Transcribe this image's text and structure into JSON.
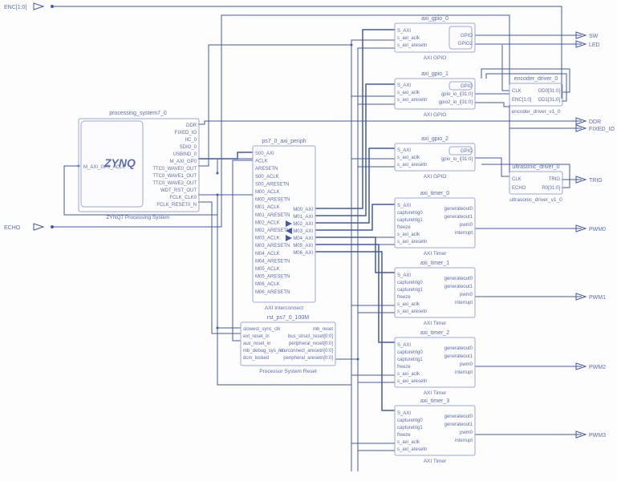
{
  "ext": {
    "enc": "ENC[1:0]",
    "echo": "ECHO",
    "sw": "SW",
    "led": "LED",
    "ddr": "DDR",
    "fixed_io": "FIXED_IO",
    "trig": "TRIG",
    "pwm0": "PWM0",
    "pwm1": "PWM1",
    "pwm2": "PWM2",
    "pwm3": "PWM3",
    "maxaclk": "M_AXI_GP0_ACLK"
  },
  "zynq": {
    "title": "processing_system7_0",
    "sub": "ZYNQ7 Processing System",
    "brand": "ZYNQ",
    "ports": [
      "DDR",
      "FIXED_IO",
      "IIC_0",
      "SDIO_0",
      "USBIND_0",
      "M_AXI_GP0",
      "TTC0_WAVE0_OUT",
      "TTC0_WAVE1_OUT",
      "TTC0_WAVE2_OUT",
      "WDT_RST_OUT",
      "FCLK_CLK0",
      "FCLK_RESET0_N"
    ]
  },
  "interconnect": {
    "title": "ps7_0_axi_periph",
    "sub": "AXI Interconnect",
    "left": [
      "S00_AXI",
      "ACLK",
      "ARESETN",
      "S00_ACLK",
      "S00_ARESETN",
      "M00_ACLK",
      "M00_ARESETN",
      "M01_ACLK",
      "M01_ARESETN",
      "M02_ACLK",
      "M02_ARESETN",
      "M03_ACLK",
      "M03_ARESETN",
      "M04_ACLK",
      "M04_ARESETN",
      "M05_ACLK",
      "M05_ARESETN",
      "M06_ACLK",
      "M06_ARESETN"
    ],
    "right": [
      "M00_AXI",
      "M01_AXI",
      "M02_AXI",
      "M03_AXI",
      "M04_AXI",
      "M05_AXI",
      "M06_AXI"
    ]
  },
  "reset": {
    "title": "rst_ps7_0_100M",
    "sub": "Processor System Reset",
    "left": [
      "slowest_sync_clk",
      "ext_reset_in",
      "aux_reset_in",
      "mb_debug_sys_rst",
      "dcm_locked"
    ],
    "right": [
      "mb_reset",
      "bus_struct_reset[0:0]",
      "peripheral_reset[0:0]",
      "interconnect_aresetn[0:0]",
      "peripheral_aresetn[0:0]"
    ]
  },
  "gpio0": {
    "title": "axi_gpio_0",
    "sub": "AXI GPIO",
    "left": [
      "S_AXI",
      "s_axi_aclk",
      "s_axi_aresetn"
    ],
    "right": [
      "GPIO",
      "GPIO2"
    ]
  },
  "gpio1": {
    "title": "axi_gpio_1",
    "sub": "AXI GPIO",
    "left": [
      "S_AXI",
      "s_axi_aclk",
      "s_axi_aresetn"
    ],
    "right": [
      "GPIO",
      "gpio_io_i[31:0]",
      "gpio2_io_i[31:0]"
    ]
  },
  "gpio2": {
    "title": "axi_gpio_2",
    "sub": "AXI GPIO",
    "left": [
      "S_AXI",
      "s_axi_aclk",
      "s_axi_aresetn"
    ],
    "right": [
      "GPIO",
      "gpio_io_i[31:0]"
    ]
  },
  "timer_left": [
    "S_AXI",
    "capturetrig0",
    "capturetrig1",
    "freeze",
    "s_axi_aclk",
    "s_axi_aresetn"
  ],
  "timer_right": [
    "generateout0",
    "generateout1",
    "pwm0",
    "interrupt"
  ],
  "timer0": {
    "title": "axi_timer_0",
    "sub": "AXI Timer"
  },
  "timer1": {
    "title": "axi_timer_1",
    "sub": "AXI Timer"
  },
  "timer2": {
    "title": "axi_timer_2",
    "sub": "AXI Timer"
  },
  "timer3": {
    "title": "axi_timer_3",
    "sub": "AXI Timer"
  },
  "encoder": {
    "title": "encoder_driver_0",
    "sub": "encoder_driver_v1_0",
    "left": [
      "CLK",
      "ENC[1:0]"
    ],
    "right": [
      "OD0[31:0]",
      "OD1[31:0]"
    ]
  },
  "ultrasonic": {
    "title": "ultrasonic_driver_0",
    "sub": "ultrasonic_driver_v1_0",
    "left": [
      "CLK",
      "ECHO"
    ],
    "right": [
      "TRIG",
      "R0[31:0]"
    ]
  }
}
